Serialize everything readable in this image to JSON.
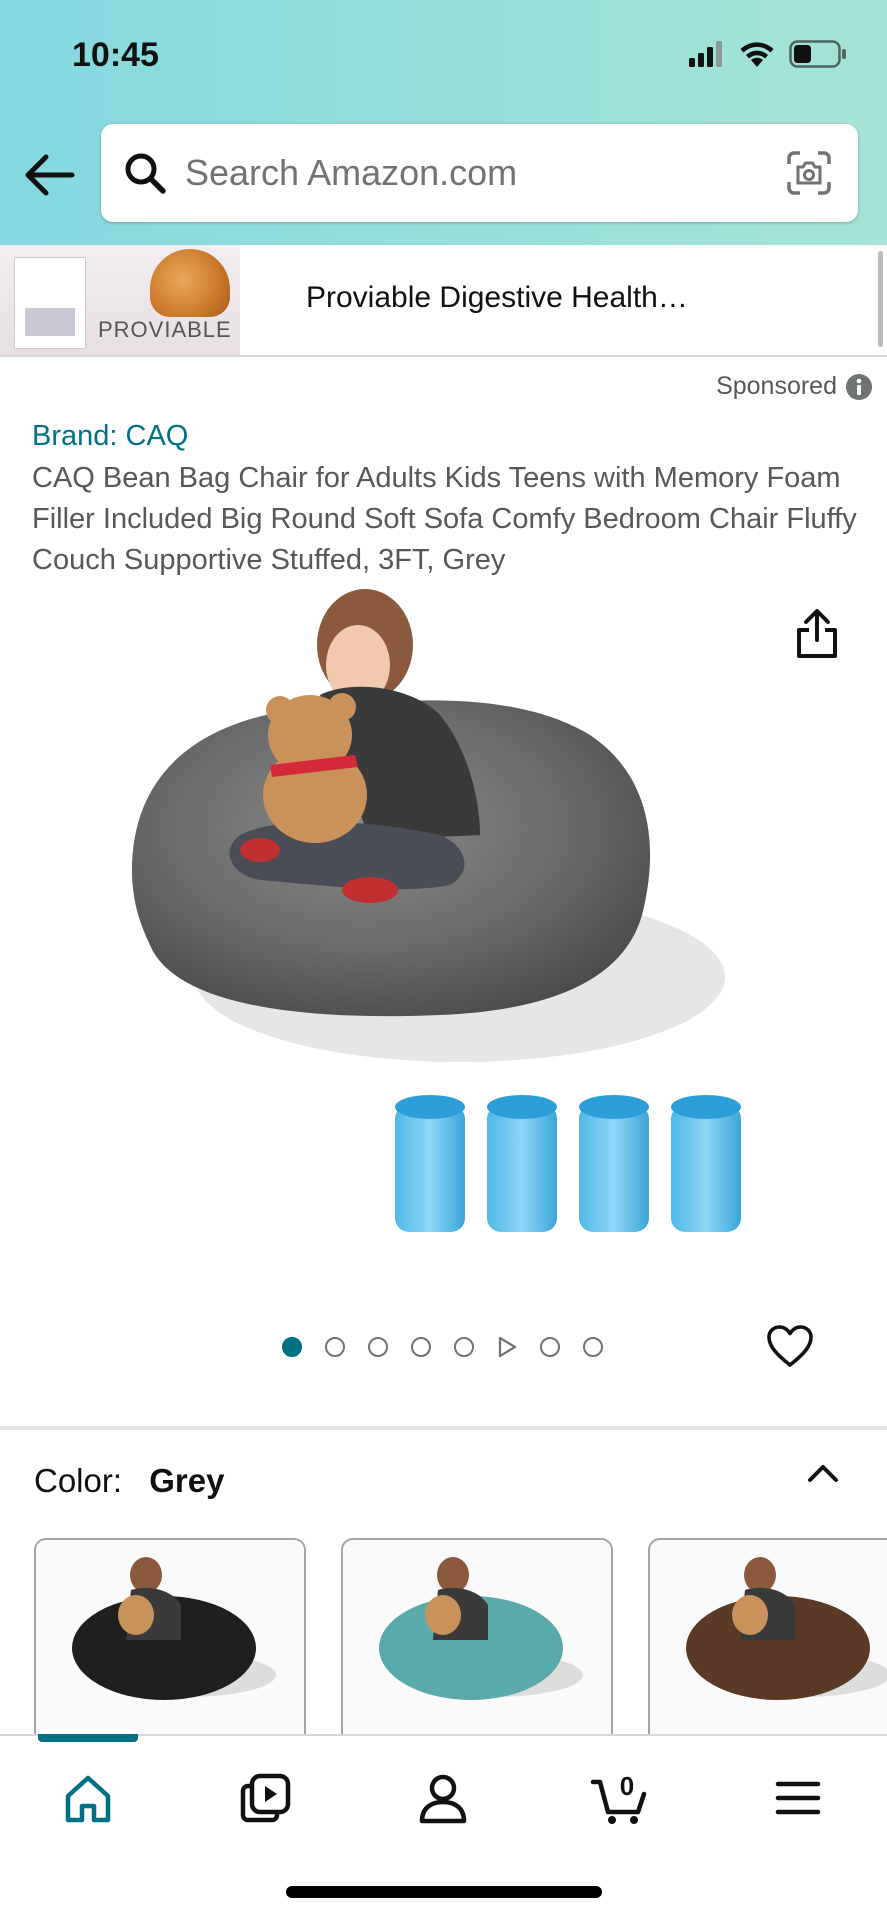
{
  "status": {
    "time": "10:45"
  },
  "search": {
    "placeholder": "Search Amazon.com"
  },
  "ad": {
    "title": "Proviable Digestive Health…",
    "logo_text": "PROVIABLE"
  },
  "sponsored": {
    "label": "Sponsored"
  },
  "product": {
    "brand": "Brand: CAQ",
    "title": "CAQ Bean Bag Chair for Adults Kids Teens with Memory Foam Filler Included Big Round Soft Sofa Comfy Bedroom Chair Fluffy Couch Supportive Stuffed, 3FT, Grey"
  },
  "gallery": {
    "total_items": 8,
    "active_index": 0,
    "video_index": 5
  },
  "color": {
    "label": "Color:",
    "value": "Grey",
    "swatches": [
      {
        "name": "black",
        "color": "#1f1f1f"
      },
      {
        "name": "teal",
        "color": "#5aa9ab"
      },
      {
        "name": "brown",
        "color": "#5a3a25"
      }
    ]
  },
  "cart": {
    "count": "0"
  },
  "colors": {
    "accent": "#007185",
    "header_start": "#84d8e0",
    "header_end": "#a6e3d6"
  }
}
